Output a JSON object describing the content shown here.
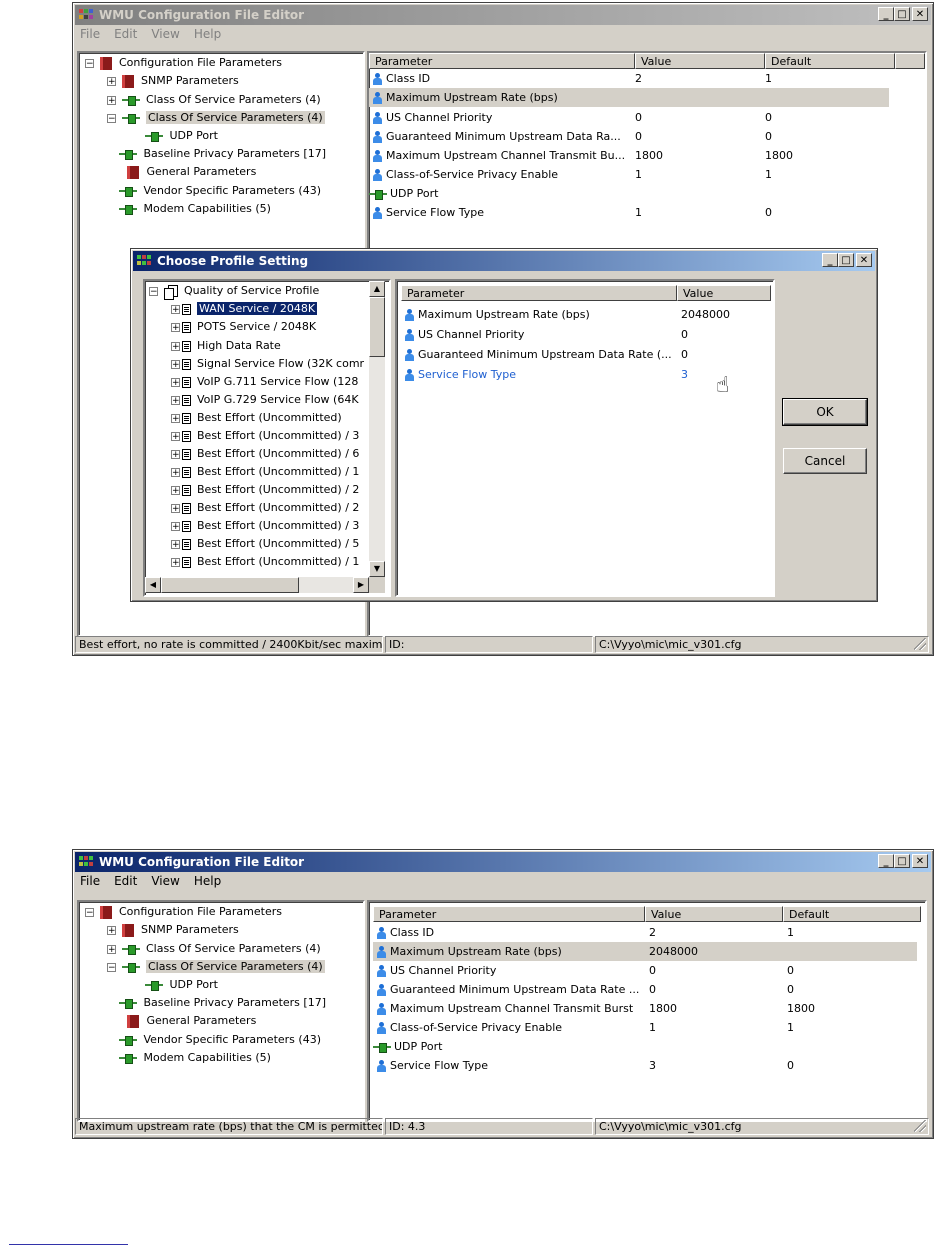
{
  "window1": {
    "title": "WMU Configuration File Editor",
    "menu": [
      "File",
      "Edit",
      "View",
      "Help"
    ],
    "tree": {
      "root": "Configuration File Parameters",
      "items": [
        {
          "label": "SNMP Parameters",
          "icon": "book-icon"
        },
        {
          "label": "Class Of Service Parameters (4)",
          "icon": "plug-icon"
        },
        {
          "label": "Class Of Service Parameters (4)",
          "icon": "plug-icon",
          "selected": true
        },
        {
          "label": "UDP Port",
          "icon": "plug-icon"
        },
        {
          "label": "Baseline Privacy Parameters [17]",
          "icon": "plug-icon"
        },
        {
          "label": "General Parameters",
          "icon": "book-icon"
        },
        {
          "label": "Vendor Specific Parameters (43)",
          "icon": "plug-icon"
        },
        {
          "label": "Modem Capabilities (5)",
          "icon": "plug-icon"
        }
      ]
    },
    "columns": [
      "Parameter",
      "Value",
      "Default"
    ],
    "rows": [
      {
        "param": "Class ID",
        "value": "2",
        "default": "1"
      },
      {
        "param": "Maximum Upstream Rate (bps)",
        "value": "",
        "default": ""
      },
      {
        "param": "US Channel Priority",
        "value": "0",
        "default": "0"
      },
      {
        "param": "Guaranteed Minimum Upstream Data Ra...",
        "value": "0",
        "default": "0"
      },
      {
        "param": "Maximum Upstream Channel Transmit Bu...",
        "value": "1800",
        "default": "1800"
      },
      {
        "param": "Class-of-Service Privacy Enable",
        "value": "1",
        "default": "1"
      },
      {
        "param": "UDP Port",
        "value": "",
        "default": ""
      },
      {
        "param": "Service Flow Type",
        "value": "1",
        "default": "0"
      }
    ],
    "status": [
      "Best effort, no rate is committed / 2400Kbit/sec maxim",
      "ID:",
      "C:\\Vyyo\\mic\\mic_v301.cfg"
    ]
  },
  "dialog": {
    "title": "Choose Profile Setting",
    "tree_root": "Quality of Service Profile",
    "profiles": [
      "WAN Service / 2048K",
      "POTS Service / 2048K",
      "High Data Rate",
      "Signal Service Flow (32K comr",
      "VoIP G.711 Service Flow (128",
      "VoIP G.729 Service Flow (64K",
      "Best Effort (Uncommitted)",
      "Best Effort (Uncommitted) / 3",
      "Best Effort (Uncommitted) / 6",
      "Best Effort (Uncommitted) / 1",
      "Best Effort (Uncommitted) / 2",
      "Best Effort (Uncommitted) / 2",
      "Best Effort (Uncommitted) / 3",
      "Best Effort (Uncommitted) / 5",
      "Best Effort (Uncommitted) / 1"
    ],
    "columns": [
      "Parameter",
      "Value"
    ],
    "rows": [
      {
        "param": "Maximum Upstream Rate (bps)",
        "value": "2048000"
      },
      {
        "param": "US Channel Priority",
        "value": "0"
      },
      {
        "param": "Guaranteed Minimum Upstream Data Rate (...",
        "value": "0"
      },
      {
        "param": "Service Flow Type",
        "value": "3"
      }
    ],
    "ok_label": "OK",
    "cancel_label": "Cancel"
  },
  "window2": {
    "title": "WMU Configuration File Editor",
    "menu": [
      "File",
      "Edit",
      "View",
      "Help"
    ],
    "tree": {
      "root": "Configuration File Parameters",
      "items": [
        {
          "label": "SNMP Parameters"
        },
        {
          "label": "Class Of Service Parameters (4)"
        },
        {
          "label": "Class Of Service Parameters (4)"
        },
        {
          "label": "UDP Port"
        },
        {
          "label": "Baseline Privacy Parameters [17]"
        },
        {
          "label": "General Parameters"
        },
        {
          "label": "Vendor Specific Parameters (43)"
        },
        {
          "label": "Modem Capabilities (5)"
        }
      ]
    },
    "columns": [
      "Parameter",
      "Value",
      "Default"
    ],
    "rows": [
      {
        "param": "Class ID",
        "value": "2",
        "default": "1"
      },
      {
        "param": "Maximum Upstream Rate (bps)",
        "value": "2048000",
        "default": ""
      },
      {
        "param": "US Channel Priority",
        "value": "0",
        "default": "0"
      },
      {
        "param": "Guaranteed Minimum Upstream Data Rate ...",
        "value": "0",
        "default": "0"
      },
      {
        "param": "Maximum Upstream Channel Transmit Burst",
        "value": "1800",
        "default": "1800"
      },
      {
        "param": "Class-of-Service Privacy Enable",
        "value": "1",
        "default": "1"
      },
      {
        "param": "UDP Port",
        "value": "",
        "default": ""
      },
      {
        "param": "Service Flow Type",
        "value": "3",
        "default": "0"
      }
    ],
    "status": [
      "Maximum upstream rate (bps) that the CM is permittec",
      "ID: 4.3",
      "C:\\Vyyo\\mic\\mic_v301.cfg"
    ]
  },
  "colors": {
    "title_active": "#0a246a",
    "title_inactive": "#808080",
    "face": "#d4d0c8",
    "link_blue": "#1e5fd0"
  }
}
